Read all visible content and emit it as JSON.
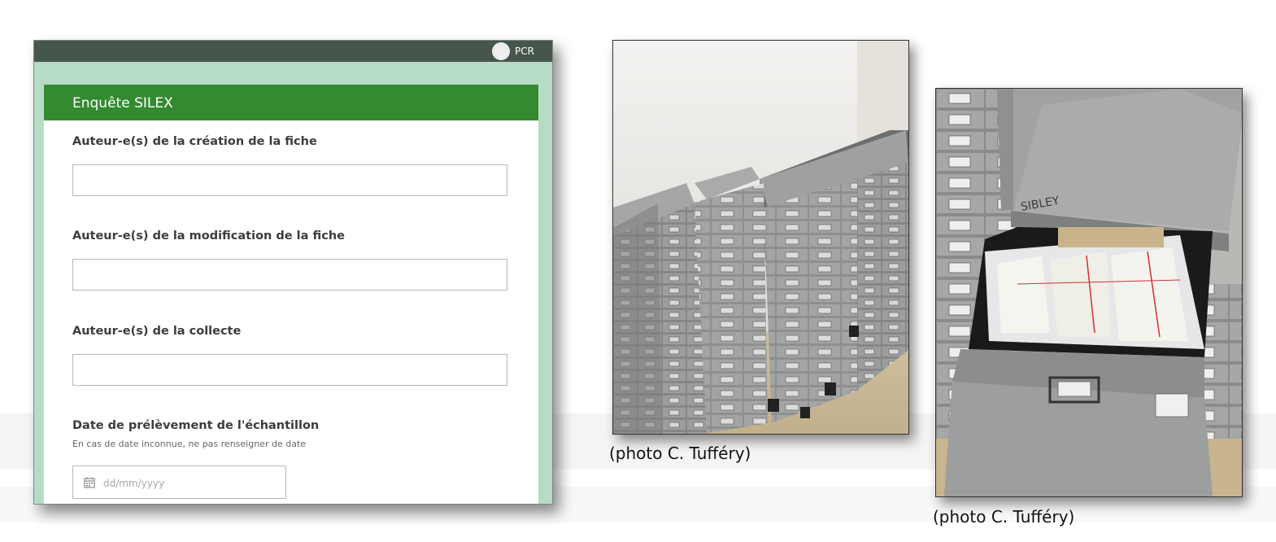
{
  "form": {
    "user_name": "PCR",
    "survey_title": "Enquête SILEX",
    "questions": [
      {
        "label": "Auteur-e(s) de la création de la fiche",
        "value": ""
      },
      {
        "label": "Auteur-e(s) de la modification de la fiche",
        "value": ""
      },
      {
        "label": "Auteur-e(s) de la collecte",
        "value": ""
      }
    ],
    "date_question": {
      "label": "Date de prélèvement de l'échantillon",
      "hint": "En cas de date inconnue, ne pas renseigner de date",
      "placeholder": "dd/mm/yyyy",
      "icon": "calendar-icon"
    }
  },
  "photos": [
    {
      "caption": "(photo C. Tufféry)"
    },
    {
      "caption": "(photo C. Tufféry)",
      "cabinet_brand": "SIBLEY"
    }
  ]
}
